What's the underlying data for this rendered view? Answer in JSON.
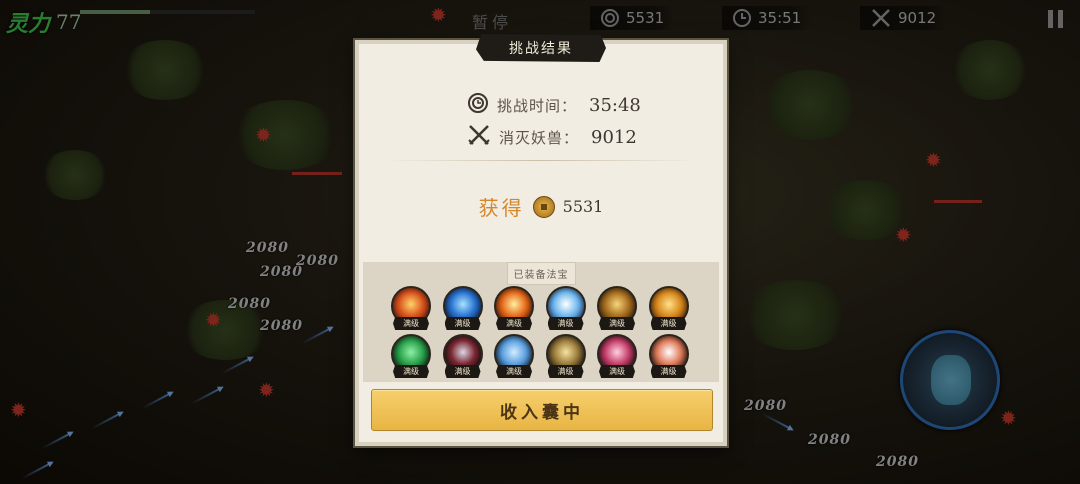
{
  "hud": {
    "lingli_label": "灵力",
    "lingli_value": "77",
    "pause_text": "暂停",
    "coins": "5531",
    "time": "35:51",
    "kills": "9012"
  },
  "scene": {
    "damage_numbers": [
      "2080",
      "2080",
      "2080",
      "2080",
      "2080",
      "2080",
      "2080",
      "2080"
    ]
  },
  "dialog": {
    "title": "挑战结果",
    "stats": [
      {
        "label": "挑战时间：",
        "value": "35:48",
        "icon": "clock-icon"
      },
      {
        "label": "消灭妖兽：",
        "value": "9012",
        "icon": "crossed-swords-icon"
      }
    ],
    "reward_label": "获得",
    "reward_value": "5531",
    "treasure_heading": "已装备法宝",
    "treasures": [
      {
        "name": "fire-orb",
        "level": "满级",
        "colors": [
          "#ffd36b",
          "#d9541e",
          "#6b1d0c"
        ]
      },
      {
        "name": "blue-vortex",
        "level": "满级",
        "colors": [
          "#a9e2ff",
          "#2a74d1",
          "#0b2452"
        ]
      },
      {
        "name": "flame-burst",
        "level": "满级",
        "colors": [
          "#fff0a0",
          "#e66a1a",
          "#5a1a08"
        ]
      },
      {
        "name": "ice-shards",
        "level": "满级",
        "colors": [
          "#ffffff",
          "#6fb7ef",
          "#1a3f73"
        ]
      },
      {
        "name": "golden-dragon",
        "level": "满级",
        "colors": [
          "#f7d57a",
          "#a66d1f",
          "#3a2408"
        ]
      },
      {
        "name": "golden-talisman",
        "level": "满级",
        "colors": [
          "#ffe08a",
          "#d8891d",
          "#5b2e09"
        ]
      },
      {
        "name": "jade-stone",
        "level": "满级",
        "colors": [
          "#8ff0a5",
          "#2aa14b",
          "#0f1f14"
        ]
      },
      {
        "name": "red-dagger",
        "level": "满级",
        "colors": [
          "#d9d9e6",
          "#7b2732",
          "#0e0e12"
        ]
      },
      {
        "name": "blue-boots",
        "level": "满级",
        "colors": [
          "#d4ecff",
          "#5a9fe0",
          "#101a26"
        ]
      },
      {
        "name": "golden-beast",
        "level": "满级",
        "colors": [
          "#f7e3a0",
          "#9a7a3a",
          "#121212"
        ]
      },
      {
        "name": "red-bowl",
        "level": "满级",
        "colors": [
          "#ffd0e0",
          "#c43d6a",
          "#140a12"
        ]
      },
      {
        "name": "silver-shield",
        "level": "满级",
        "colors": [
          "#ffffff",
          "#e07a5a",
          "#15110d"
        ]
      }
    ],
    "collect_button": "收入囊中"
  },
  "colors": {
    "accent_gold": "#e8b544",
    "reward_orange": "#d4862e",
    "lingli_green": "#3fc14a"
  }
}
